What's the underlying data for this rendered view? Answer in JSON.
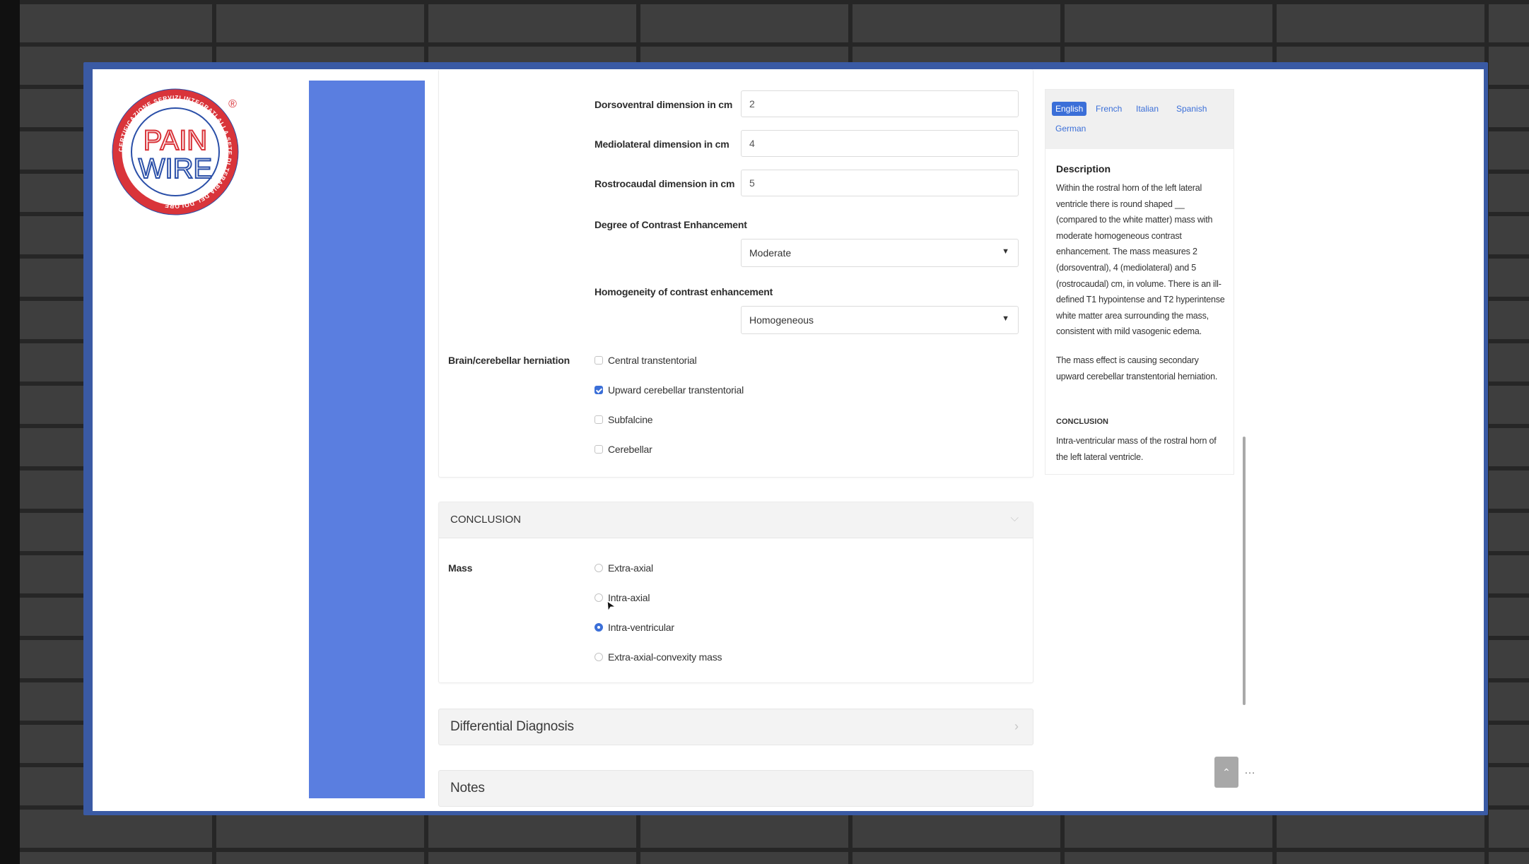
{
  "brand": {
    "logo_top": "PAIN",
    "logo_bottom": "WIRE",
    "ring_text": "CERTIFICAZIONE SERVIZI INTEGRATI ALLA SETE DI TERAPIA DEL DOLORE",
    "registered": "®"
  },
  "form": {
    "dorsoventral": {
      "label": "Dorsoventral dimension in cm",
      "value": "2"
    },
    "mediolateral": {
      "label": "Mediolateral dimension in cm",
      "value": "4"
    },
    "rostrocaudal": {
      "label": "Rostrocaudal dimension in cm",
      "value": "5"
    },
    "contrast_degree": {
      "label": "Degree of Contrast Enhancement",
      "value": "Moderate"
    },
    "contrast_homogeneity": {
      "label": "Homogeneity of contrast enhancement",
      "value": "Homogeneous"
    },
    "herniation": {
      "label": "Brain/cerebellar herniation",
      "options": [
        {
          "label": "Central transtentorial",
          "checked": false
        },
        {
          "label": "Upward cerebellar transtentorial",
          "checked": true
        },
        {
          "label": "Subfalcine",
          "checked": false
        },
        {
          "label": "Cerebellar",
          "checked": false
        }
      ]
    }
  },
  "conclusion": {
    "header": "CONCLUSION",
    "mass": {
      "label": "Mass",
      "options": [
        {
          "label": "Extra-axial",
          "selected": false
        },
        {
          "label": "Intra-axial",
          "selected": false
        },
        {
          "label": "Intra-ventricular",
          "selected": true
        },
        {
          "label": "Extra-axial-convexity mass",
          "selected": false
        }
      ]
    }
  },
  "accordions": {
    "differential": "Differential Diagnosis",
    "notes": "Notes"
  },
  "description_panel": {
    "languages": [
      "English",
      "French",
      "Italian",
      "Spanish",
      "German"
    ],
    "active_language": "English",
    "title": "Description",
    "paragraph1": "Within the rostral horn of the left lateral ventricle there is round shaped __ (compared to the white matter) mass with moderate homogeneous contrast enhancement. The mass measures 2 (dorsoventral), 4 (mediolateral) and 5 (rostrocaudal) cm, in volume. There is an ill-defined T1 hypointense and T2 hyperintense white matter area surrounding the mass, consistent with mild vasogenic edema.",
    "paragraph2": "The mass effect is causing secondary upward cerebellar transtentorial herniation.",
    "conclusion_heading": "CONCLUSION",
    "conclusion_text": "Intra-ventricular mass of the rostral horn of the left lateral ventricle."
  },
  "controls": {
    "up_symbol": "⌃",
    "more_symbol": "…"
  },
  "colors": {
    "accent": "#3b6fd8",
    "sidebar": "#5a7ee0",
    "frame": "#3a5aa4",
    "logo_red": "#d9343a",
    "logo_blue": "#2a4fa8"
  }
}
